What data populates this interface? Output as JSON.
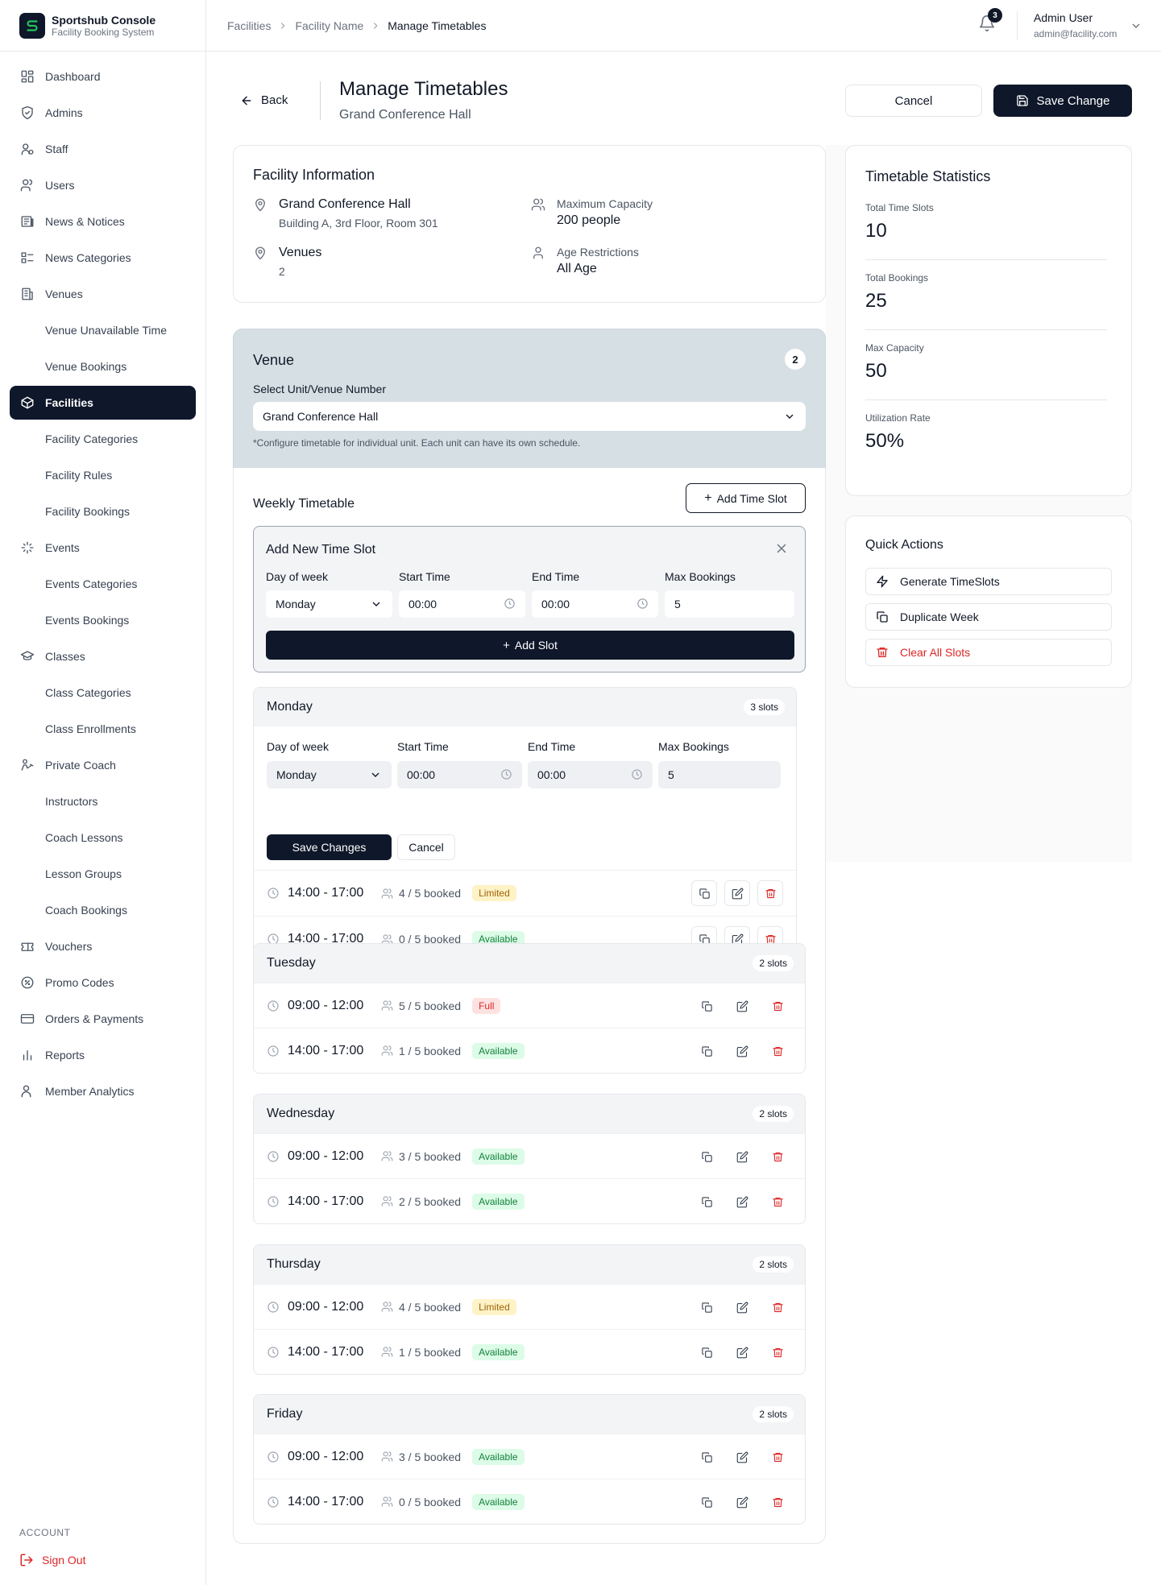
{
  "brand": {
    "name": "Sportshub Console",
    "subtitle": "Facility Booking System"
  },
  "sidebar": {
    "items": [
      {
        "label": "Dashboard",
        "icon": "dashboard-icon",
        "sub": false
      },
      {
        "label": "Admins",
        "icon": "shield-icon",
        "sub": false
      },
      {
        "label": "Staff",
        "icon": "staff-icon",
        "sub": false
      },
      {
        "label": "Users",
        "icon": "users-icon",
        "sub": false
      },
      {
        "label": "News & Notices",
        "icon": "newspaper-icon",
        "sub": false
      },
      {
        "label": "News Categories",
        "icon": "categories-icon",
        "sub": false
      },
      {
        "label": "Venues",
        "icon": "building-icon",
        "sub": false
      },
      {
        "label": "Venue Unavailable Time",
        "sub": true
      },
      {
        "label": "Venue Bookings",
        "sub": true
      },
      {
        "label": "Facilities",
        "icon": "box-icon",
        "sub": false,
        "active": true
      },
      {
        "label": "Facility Categories",
        "sub": true
      },
      {
        "label": "Facility Rules",
        "sub": true
      },
      {
        "label": "Facility Bookings",
        "sub": true
      },
      {
        "label": "Events",
        "icon": "sparkle-icon",
        "sub": false
      },
      {
        "label": "Events Categories",
        "sub": true
      },
      {
        "label": "Events Bookings",
        "sub": true
      },
      {
        "label": "Classes",
        "icon": "graduation-cap-icon",
        "sub": false
      },
      {
        "label": "Class Categories",
        "sub": true
      },
      {
        "label": "Class Enrollments",
        "sub": true
      },
      {
        "label": "Private Coach",
        "icon": "coach-icon",
        "sub": false
      },
      {
        "label": "Instructors",
        "sub": true
      },
      {
        "label": "Coach Lessons",
        "sub": true
      },
      {
        "label": "Lesson Groups",
        "sub": true
      },
      {
        "label": "Coach Bookings",
        "sub": true
      },
      {
        "label": "Vouchers",
        "icon": "ticket-icon",
        "sub": false
      },
      {
        "label": "Promo Codes",
        "icon": "badge-percent-icon",
        "sub": false
      },
      {
        "label": "Orders & Payments",
        "icon": "credit-card-icon",
        "sub": false
      },
      {
        "label": "Reports",
        "icon": "bar-chart-icon",
        "sub": false
      },
      {
        "label": "Member Analytics",
        "icon": "user-analytics-icon",
        "sub": false
      }
    ],
    "account_label": "ACCOUNT",
    "signout_label": "Sign Out"
  },
  "header": {
    "breadcrumb": [
      "Facilities",
      "Facility Name",
      "Manage Timetables"
    ],
    "notifications": "3",
    "user_name": "Admin User",
    "user_email": "admin@facility.com"
  },
  "page": {
    "back_label": "Back",
    "title": "Manage Timetables",
    "subtitle": "Grand Conference Hall",
    "cancel_label": "Cancel",
    "save_label": "Save Change"
  },
  "facility": {
    "title": "Facility Information",
    "name": "Grand Conference Hall",
    "location": "Building A, 3rd Floor, Room 301",
    "venues_label": "Venues",
    "venues_value": "2",
    "capacity_label": "Maximum Capacity",
    "capacity_value": "200 people",
    "age_label": "Age Restrictions",
    "age_value": "All Age"
  },
  "venue": {
    "title": "Venue",
    "count": "2",
    "select_label": "Select Unit/Venue Number",
    "selected": "Grand Conference Hall",
    "note": "*Configure timetable for individual unit. Each unit can have its own schedule."
  },
  "timetable": {
    "title": "Weekly Timetable",
    "add_button": "Add Time Slot",
    "new_slot": {
      "title": "Add New Time Slot",
      "day_label": "Day of week",
      "day_value": "Monday",
      "start_label": "Start Time",
      "start_value": "00:00",
      "end_label": "End Time",
      "end_value": "00:00",
      "max_label": "Max Bookings",
      "max_value": "5",
      "submit": "Add Slot"
    },
    "edit": {
      "day_label": "Day of week",
      "day_value": "Monday",
      "start_label": "Start Time",
      "start_value": "00:00",
      "end_label": "End Time",
      "end_value": "00:00",
      "max_label": "Max Bookings",
      "max_value": "5",
      "save": "Save Changes",
      "cancel": "Cancel"
    },
    "days": [
      {
        "name": "Monday",
        "count": "3 slots",
        "slots": [
          {
            "time": "14:00 - 17:00",
            "booked": "4 / 5 booked",
            "status": "Limited",
            "kind": "limited"
          },
          {
            "time": "14:00 - 17:00",
            "booked": "0 / 5 booked",
            "status": "Available",
            "kind": "available"
          }
        ]
      },
      {
        "name": "Tuesday",
        "count": "2 slots",
        "slots": [
          {
            "time": "09:00 - 12:00",
            "booked": "5 / 5 booked",
            "status": "Full",
            "kind": "full"
          },
          {
            "time": "14:00 - 17:00",
            "booked": "1 / 5 booked",
            "status": "Available",
            "kind": "available"
          }
        ]
      },
      {
        "name": "Wednesday",
        "count": "2 slots",
        "slots": [
          {
            "time": "09:00 - 12:00",
            "booked": "3 / 5 booked",
            "status": "Available",
            "kind": "available"
          },
          {
            "time": "14:00 - 17:00",
            "booked": "2 / 5 booked",
            "status": "Available",
            "kind": "available"
          }
        ]
      },
      {
        "name": "Thursday",
        "count": "2 slots",
        "slots": [
          {
            "time": "09:00 - 12:00",
            "booked": "4 / 5 booked",
            "status": "Limited",
            "kind": "limited"
          },
          {
            "time": "14:00 - 17:00",
            "booked": "1 / 5 booked",
            "status": "Available",
            "kind": "available"
          }
        ]
      },
      {
        "name": "Friday",
        "count": "2 slots",
        "slots": [
          {
            "time": "09:00 - 12:00",
            "booked": "3 / 5 booked",
            "status": "Available",
            "kind": "available"
          },
          {
            "time": "14:00 - 17:00",
            "booked": "0 / 5 booked",
            "status": "Available",
            "kind": "available"
          }
        ]
      }
    ]
  },
  "stats": {
    "title": "Timetable Statistics",
    "items": [
      {
        "label": "Total Time Slots",
        "value": "10"
      },
      {
        "label": "Total Bookings",
        "value": "25"
      },
      {
        "label": "Max Capacity",
        "value": "50"
      },
      {
        "label": "Utilization Rate",
        "value": "50%"
      }
    ]
  },
  "quick_actions": {
    "title": "Quick Actions",
    "generate": "Generate TimeSlots",
    "duplicate": "Duplicate Week",
    "clear": "Clear All Slots"
  },
  "colors": {
    "primary": "#0f172a",
    "danger": "#dc2626",
    "venue_panel": "#d6dfe4"
  }
}
